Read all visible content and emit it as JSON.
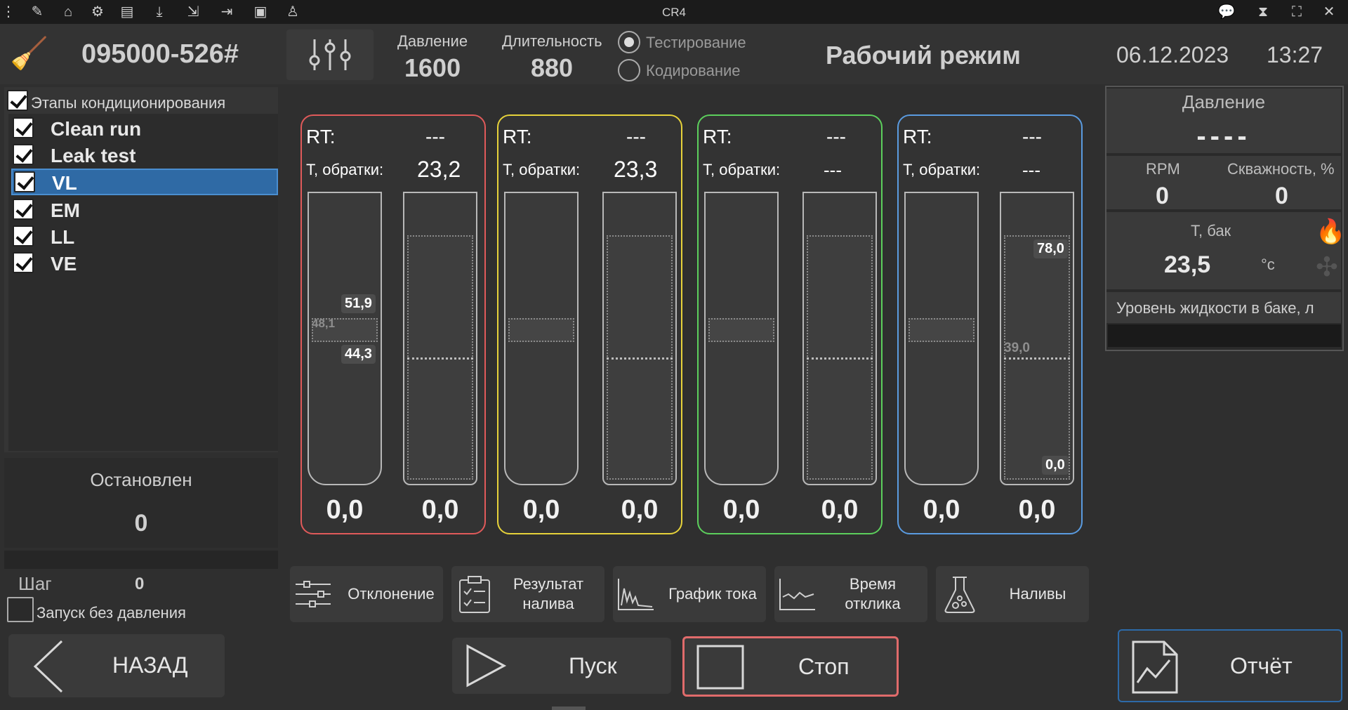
{
  "titlebar": {
    "title": "CR4",
    "icons_left": [
      "more-icon",
      "pencil-icon",
      "home-icon",
      "gear-icon",
      "toolbox-icon",
      "download-icon",
      "import-icon",
      "export-icon",
      "clipboard-icon",
      "worker-icon"
    ],
    "icons_right": [
      "chat-icon",
      "hourglass-icon",
      "fullscreen-icon",
      "close-icon"
    ]
  },
  "header": {
    "serial": "095000-526#",
    "pressure_label": "Давление",
    "pressure_value": "1600",
    "duration_label": "Длительность",
    "duration_value": "880",
    "mode_options": [
      {
        "label": "Тестирование",
        "selected": true
      },
      {
        "label": "Кодирование",
        "selected": false
      }
    ],
    "mode_title": "Рабочий режим",
    "date": "06.12.2023",
    "time": "13:27"
  },
  "stages": {
    "header_label": "Этапы кондиционирования",
    "header_checked": true,
    "items": [
      {
        "label": "Clean run",
        "checked": true,
        "selected": false
      },
      {
        "label": "Leak test",
        "checked": true,
        "selected": false
      },
      {
        "label": "VL",
        "checked": true,
        "selected": true
      },
      {
        "label": "EM",
        "checked": true,
        "selected": false
      },
      {
        "label": "LL",
        "checked": true,
        "selected": false
      },
      {
        "label": "VE",
        "checked": true,
        "selected": false
      }
    ]
  },
  "status": {
    "state": "Остановлен",
    "value": "0",
    "step_label": "Шаг",
    "step_value": "0",
    "no_pressure_label": "Запуск без давления",
    "no_pressure_checked": false
  },
  "cards": [
    {
      "color": "#e05a5a",
      "rt_label": "RT:",
      "rt_value": "---",
      "t_label": "Т, обратки:",
      "t_value": "23,2",
      "left_value": "0,0",
      "right_value": "0,0",
      "band_labels": {
        "upper": "51,9",
        "mid": "48,1",
        "lower": "44,3"
      }
    },
    {
      "color": "#e6d23a",
      "rt_label": "RT:",
      "rt_value": "---",
      "t_label": "Т, обратки:",
      "t_value": "23,3",
      "left_value": "0,0",
      "right_value": "0,0"
    },
    {
      "color": "#5ccf5c",
      "rt_label": "RT:",
      "rt_value": "---",
      "t_label": "Т, обратки:",
      "t_value": "---",
      "left_value": "0,0",
      "right_value": "0,0"
    },
    {
      "color": "#5a9be0",
      "rt_label": "RT:",
      "rt_value": "---",
      "t_label": "Т, обратки:",
      "t_value": "---",
      "left_value": "0,0",
      "right_value": "0,0",
      "right_labels": {
        "top": "78,0",
        "mid": "39,0",
        "bottom": "0,0"
      }
    }
  ],
  "function_buttons": [
    {
      "label": "Отклонение",
      "icon": "sliders-icon"
    },
    {
      "label": "Результат налива",
      "icon": "checklist-icon"
    },
    {
      "label": "График тока",
      "icon": "current-graph-icon"
    },
    {
      "label": "Время отклика",
      "icon": "response-time-icon"
    },
    {
      "label": "Наливы",
      "icon": "flask-icon"
    }
  ],
  "nav": {
    "back": "НАЗАД",
    "start": "Пуск",
    "stop": "Стоп",
    "report": "Отчёт"
  },
  "right_panel": {
    "pressure_label": "Давление",
    "pressure_value": "----",
    "rpm_label": "RPM",
    "rpm_value": "0",
    "duty_label": "Скважность, %",
    "duty_value": "0",
    "tank_label": "Т, бак",
    "tank_value": "23,5",
    "tank_unit": "°c",
    "level_label": "Уровень жидкости в баке, л"
  }
}
